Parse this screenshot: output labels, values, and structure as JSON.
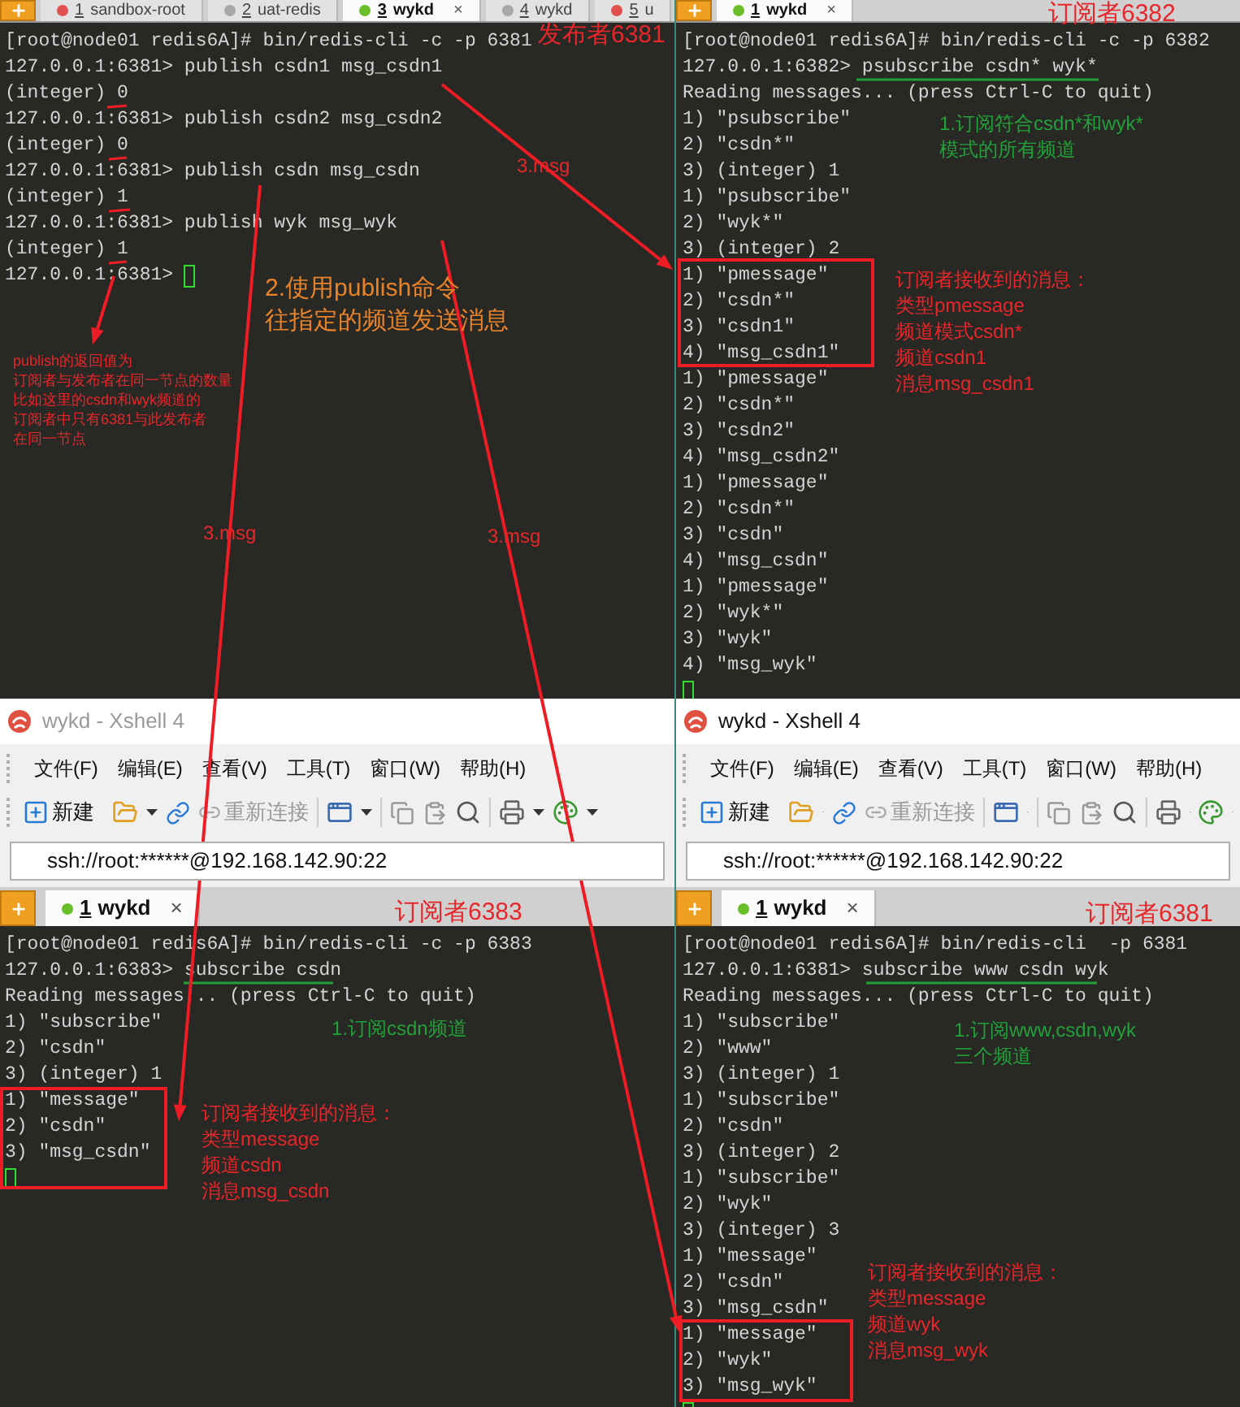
{
  "top_panes": [
    {
      "tabs": [
        {
          "number": "1",
          "label": "sandbox-root",
          "color": "#e25050",
          "selected": false
        },
        {
          "number": "2",
          "label": "uat-redis",
          "color": "#a8a8a8",
          "selected": false
        },
        {
          "number": "3",
          "label": "wykd",
          "color": "#6abf2a",
          "selected": true,
          "close": "×"
        },
        {
          "number": "4",
          "label": "wykd",
          "color": "#a8a8a8",
          "selected": false
        },
        {
          "number": "5",
          "label": "u",
          "color": "#e25050",
          "selected": false
        }
      ],
      "terminal": {
        "cursor_inline": true,
        "lines": [
          "[root@node01 redis6A]# bin/redis-cli -c -p 6381",
          "127.0.0.1:6381> publish csdn1 msg_csdn1",
          "(integer) 0",
          "127.0.0.1:6381> publish csdn2 msg_csdn2",
          "(integer) 0",
          "127.0.0.1:6381> publish csdn msg_csdn",
          "(integer) 1",
          "127.0.0.1:6381> publish wyk msg_wyk",
          "(integer) 1",
          "127.0.0.1:6381> "
        ]
      }
    },
    {
      "tabs": [
        {
          "number": "1",
          "label": "wykd",
          "color": "#6abf2a",
          "selected": true,
          "close": "×"
        }
      ],
      "terminal": {
        "cursor_inline": false,
        "lines": [
          "[root@node01 redis6A]# bin/redis-cli -c -p 6382",
          "127.0.0.1:6382> psubscribe csdn* wyk*",
          "Reading messages... (press Ctrl-C to quit)",
          "1) \"psubscribe\"",
          "2) \"csdn*\"",
          "3) (integer) 1",
          "1) \"psubscribe\"",
          "2) \"wyk*\"",
          "3) (integer) 2",
          "1) \"pmessage\"",
          "2) \"csdn*\"",
          "3) \"csdn1\"",
          "4) \"msg_csdn1\"",
          "1) \"pmessage\"",
          "2) \"csdn*\"",
          "3) \"csdn2\"",
          "4) \"msg_csdn2\"",
          "1) \"pmessage\"",
          "2) \"csdn*\"",
          "3) \"csdn\"",
          "4) \"msg_csdn\"",
          "1) \"pmessage\"",
          "2) \"wyk*\"",
          "3) \"wyk\"",
          "4) \"msg_wyk\""
        ]
      }
    }
  ],
  "bottom_panes": [
    {
      "title": "wykd - Xshell 4",
      "active": false,
      "menu": [
        "文件(F)",
        "编辑(E)",
        "查看(V)",
        "工具(T)",
        "窗口(W)",
        "帮助(H)"
      ],
      "toolbar": [
        {
          "label": "新建",
          "disabled": false
        },
        {
          "label": "重新连接",
          "disabled": true
        }
      ],
      "address": "ssh://root:******@192.168.142.90:22",
      "tabs": [
        {
          "number": "1",
          "label": "wykd",
          "color": "#6abf2a",
          "selected": true,
          "close": "×"
        }
      ],
      "terminal": {
        "cursor_inline": false,
        "lines": [
          "[root@node01 redis6A]# bin/redis-cli -c -p 6383",
          "127.0.0.1:6383> subscribe csdn",
          "Reading messages... (press Ctrl-C to quit)",
          "1) \"subscribe\"",
          "2) \"csdn\"",
          "3) (integer) 1",
          "1) \"message\"",
          "2) \"csdn\"",
          "3) \"msg_csdn\""
        ]
      }
    },
    {
      "title": "wykd - Xshell 4",
      "active": true,
      "menu": [
        "文件(F)",
        "编辑(E)",
        "查看(V)",
        "工具(T)",
        "窗口(W)",
        "帮助(H)"
      ],
      "toolbar": [
        {
          "label": "新建",
          "disabled": false
        },
        {
          "label": "重新连接",
          "disabled": true
        }
      ],
      "address": "ssh://root:******@192.168.142.90:22",
      "tabs": [
        {
          "number": "1",
          "label": "wykd",
          "color": "#6abf2a",
          "selected": true,
          "close": "×"
        }
      ],
      "terminal": {
        "cursor_inline": false,
        "lines": [
          "[root@node01 redis6A]# bin/redis-cli  -p 6381",
          "127.0.0.1:6381> subscribe www csdn wyk",
          "Reading messages... (press Ctrl-C to quit)",
          "1) \"subscribe\"",
          "2) \"www\"",
          "3) (integer) 1",
          "1) \"subscribe\"",
          "2) \"csdn\"",
          "3) (integer) 2",
          "1) \"subscribe\"",
          "2) \"wyk\"",
          "3) (integer) 3",
          "1) \"message\"",
          "2) \"csdn\"",
          "3) \"msg_csdn\"",
          "1) \"message\"",
          "2) \"wyk\"",
          "3) \"msg_wyk\""
        ]
      }
    }
  ],
  "annotations": [
    {
      "kind": "heading",
      "lines": [
        "发布者6381"
      ],
      "color": "#e8262a"
    },
    {
      "kind": "heading",
      "lines": [
        "订阅者6382"
      ],
      "color": "#e8262a"
    },
    {
      "kind": "label",
      "lines": [
        "3.msg"
      ],
      "color": "#e8262a"
    },
    {
      "kind": "note",
      "lines": [
        "1.订阅符合csdn*和wyk*",
        "模式的所有频道"
      ],
      "color": "#22a03a"
    },
    {
      "kind": "big_note",
      "lines": [
        "2.使用publish命令",
        "往指定的频道发送消息"
      ],
      "color": "#e8832a"
    },
    {
      "kind": "note",
      "lines": [
        "订阅者接收到的消息：",
        "类型pmessage",
        "频道模式csdn*",
        "频道csdn1",
        "消息msg_csdn1"
      ],
      "color": "#e8262a"
    },
    {
      "kind": "small_note",
      "lines": [
        "publish的返回值为",
        "订阅者与发布者在同一节点的数量",
        "比如这里的csdn和wyk频道的",
        "订阅者中只有6381与此发布者",
        "在同一节点"
      ],
      "color": "#e8262a"
    },
    {
      "kind": "label",
      "lines": [
        "3.msg"
      ],
      "color": "#e8262a"
    },
    {
      "kind": "label",
      "lines": [
        "3.msg"
      ],
      "color": "#e8262a"
    },
    {
      "kind": "heading",
      "lines": [
        "订阅者6383"
      ],
      "color": "#e8262a"
    },
    {
      "kind": "heading",
      "lines": [
        "订阅者6381"
      ],
      "color": "#e8262a"
    },
    {
      "kind": "note",
      "lines": [
        "1.订阅csdn频道"
      ],
      "color": "#22a03a"
    },
    {
      "kind": "note",
      "lines": [
        "1.订阅www,csdn,wyk",
        "三个频道"
      ],
      "color": "#22a03a"
    },
    {
      "kind": "note",
      "lines": [
        "订阅者接收到的消息：",
        "类型message",
        "频道csdn",
        "消息msg_csdn"
      ],
      "color": "#e8262a"
    },
    {
      "kind": "note",
      "lines": [
        "订阅者接收到的消息：",
        "类型message",
        "频道wyk",
        "消息msg_wyk"
      ],
      "color": "#e8262a"
    }
  ]
}
